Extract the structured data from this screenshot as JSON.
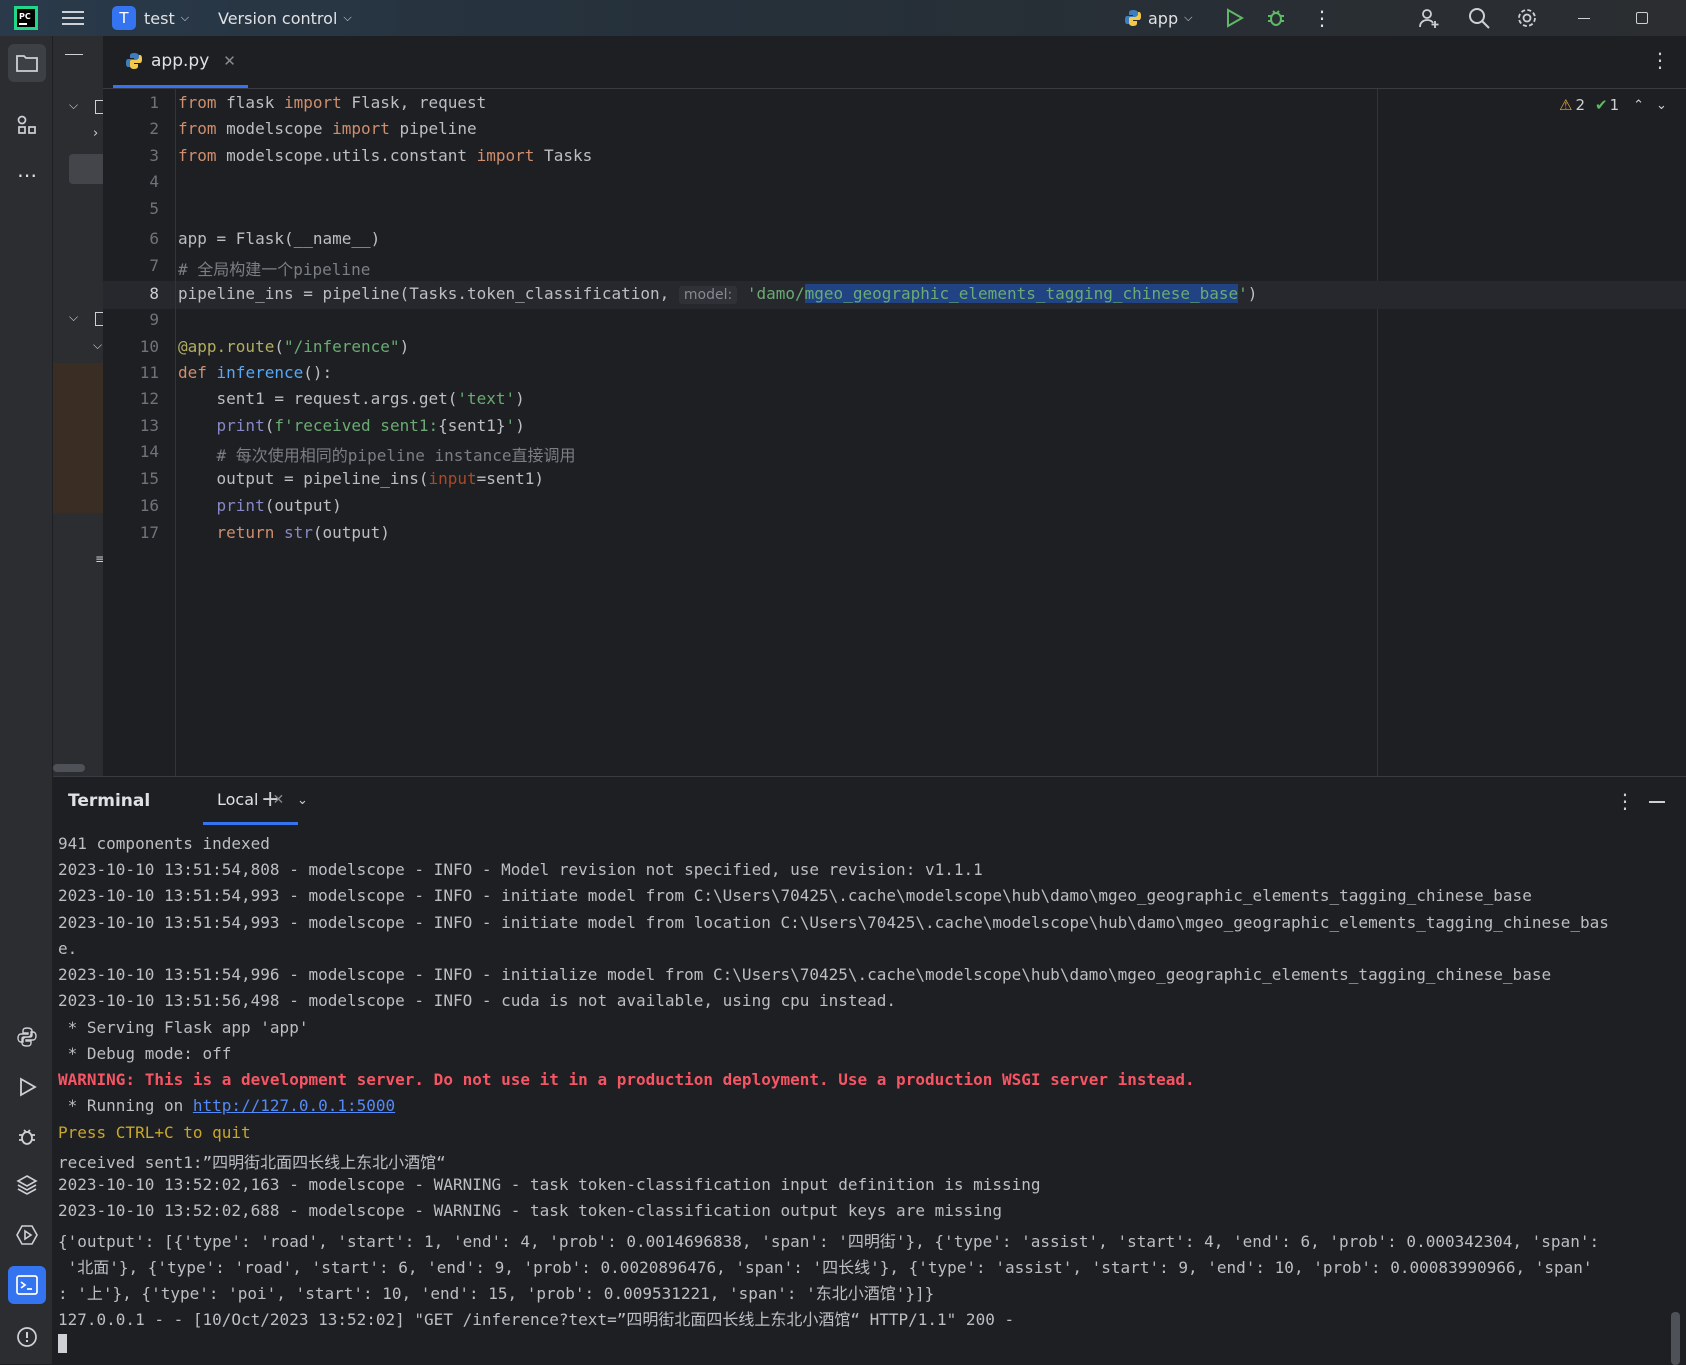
{
  "titlebar": {
    "project_initial": "T",
    "project_name": "test",
    "vcs_label": "Version control",
    "run_config": "app"
  },
  "editor": {
    "tab_name": "app.py",
    "inspections": {
      "warnings": "2",
      "ok": "1"
    },
    "line_numbers": [
      "1",
      "2",
      "3",
      "4",
      "5",
      "6",
      "7",
      "8",
      "9",
      "10",
      "11",
      "12",
      "13",
      "14",
      "15",
      "16",
      "17"
    ],
    "lines": {
      "l1": [
        "from",
        " flask ",
        "import",
        " Flask, request"
      ],
      "l2": [
        "from",
        " modelscope ",
        "import",
        " pipeline"
      ],
      "l3": [
        "from",
        " modelscope.utils.constant ",
        "import",
        " Tasks"
      ],
      "l6": "app = Flask(__name__)",
      "l7": "# 全局构建一个pipeline",
      "l8_a": "pipeline_ins = pipeline(Tasks.token_classification, ",
      "l8_hint": "model:",
      "l8_str1": " 'damo/",
      "l8_str2": "mgeo_geographic_elements_tagging_chinese_base",
      "l8_str3": "'",
      "l8_b": ")",
      "l10_a": "@app.route",
      "l10_b": "(",
      "l10_c": "\"/inference\"",
      "l10_d": ")",
      "l11_a": "def",
      "l11_b": " inference",
      "l11_c": "():",
      "l12_a": "    sent1 = request.args.get(",
      "l12_b": "'text'",
      "l12_c": ")",
      "l13_a": "    ",
      "l13_b": "print",
      "l13_c": "(",
      "l13_d": "f'received sent1:",
      "l13_e": "{sent1}",
      "l13_f": "'",
      "l13_g": ")",
      "l14": "    # 每次使用相同的pipeline instance直接调用",
      "l15_a": "    output = pipeline_ins(",
      "l15_b": "input",
      "l15_c": "=sent1)",
      "l16_a": "    ",
      "l16_b": "print",
      "l16_c": "(output)",
      "l17_a": "    ",
      "l17_b": "return",
      "l17_c": " ",
      "l17_d": "str",
      "l17_e": "(output)"
    }
  },
  "terminal": {
    "title": "Terminal",
    "tab": "Local",
    "lines": [
      "941 components indexed",
      "2023-10-10 13:51:54,808 - modelscope - INFO - Model revision not specified, use revision: v1.1.1",
      "2023-10-10 13:51:54,993 - modelscope - INFO - initiate model from C:\\Users\\70425\\.cache\\modelscope\\hub\\damo\\mgeo_geographic_elements_tagging_chinese_base",
      "2023-10-10 13:51:54,993 - modelscope - INFO - initiate model from location C:\\Users\\70425\\.cache\\modelscope\\hub\\damo\\mgeo_geographic_elements_tagging_chinese_bas",
      "e.",
      "2023-10-10 13:51:54,996 - modelscope - INFO - initialize model from C:\\Users\\70425\\.cache\\modelscope\\hub\\damo\\mgeo_geographic_elements_tagging_chinese_base",
      "2023-10-10 13:51:56,498 - modelscope - INFO - cuda is not available, using cpu instead.",
      " * Serving Flask app 'app'",
      " * Debug mode: off"
    ],
    "warning": "WARNING: This is a development server. Do not use it in a production deployment. Use a production WSGI server instead.",
    "running_prefix": " * Running on ",
    "running_url": "http://127.0.0.1:5000",
    "quit_hint": "Press CTRL+C to quit",
    "lines2": [
      "received sent1:”四明街北面四长线上东北小酒馆“",
      "2023-10-10 13:52:02,163 - modelscope - WARNING - task token-classification input definition is missing",
      "2023-10-10 13:52:02,688 - modelscope - WARNING - task token-classification output keys are missing",
      "{'output': [{'type': 'road', 'start': 1, 'end': 4, 'prob': 0.0014696838, 'span': '四明街'}, {'type': 'assist', 'start': 4, 'end': 6, 'prob': 0.000342304, 'span':",
      " '北面'}, {'type': 'road', 'start': 6, 'end': 9, 'prob': 0.0020896476, 'span': '四长线'}, {'type': 'assist', 'start': 9, 'end': 10, 'prob': 0.00083990966, 'span'",
      ": '上'}, {'type': 'poi', 'start': 10, 'end': 15, 'prob': 0.009531221, 'span': '东北小酒馆'}]}",
      "127.0.0.1 - - [10/Oct/2023 13:52:02] \"GET /inference?text=”四明街北面四长线上东北小酒馆“ HTTP/1.1\" 200 -"
    ]
  },
  "colors": {
    "accent": "#3574f0",
    "warning_red": "#f75464",
    "keyword": "#cf8e6d",
    "string": "#6aab73"
  }
}
